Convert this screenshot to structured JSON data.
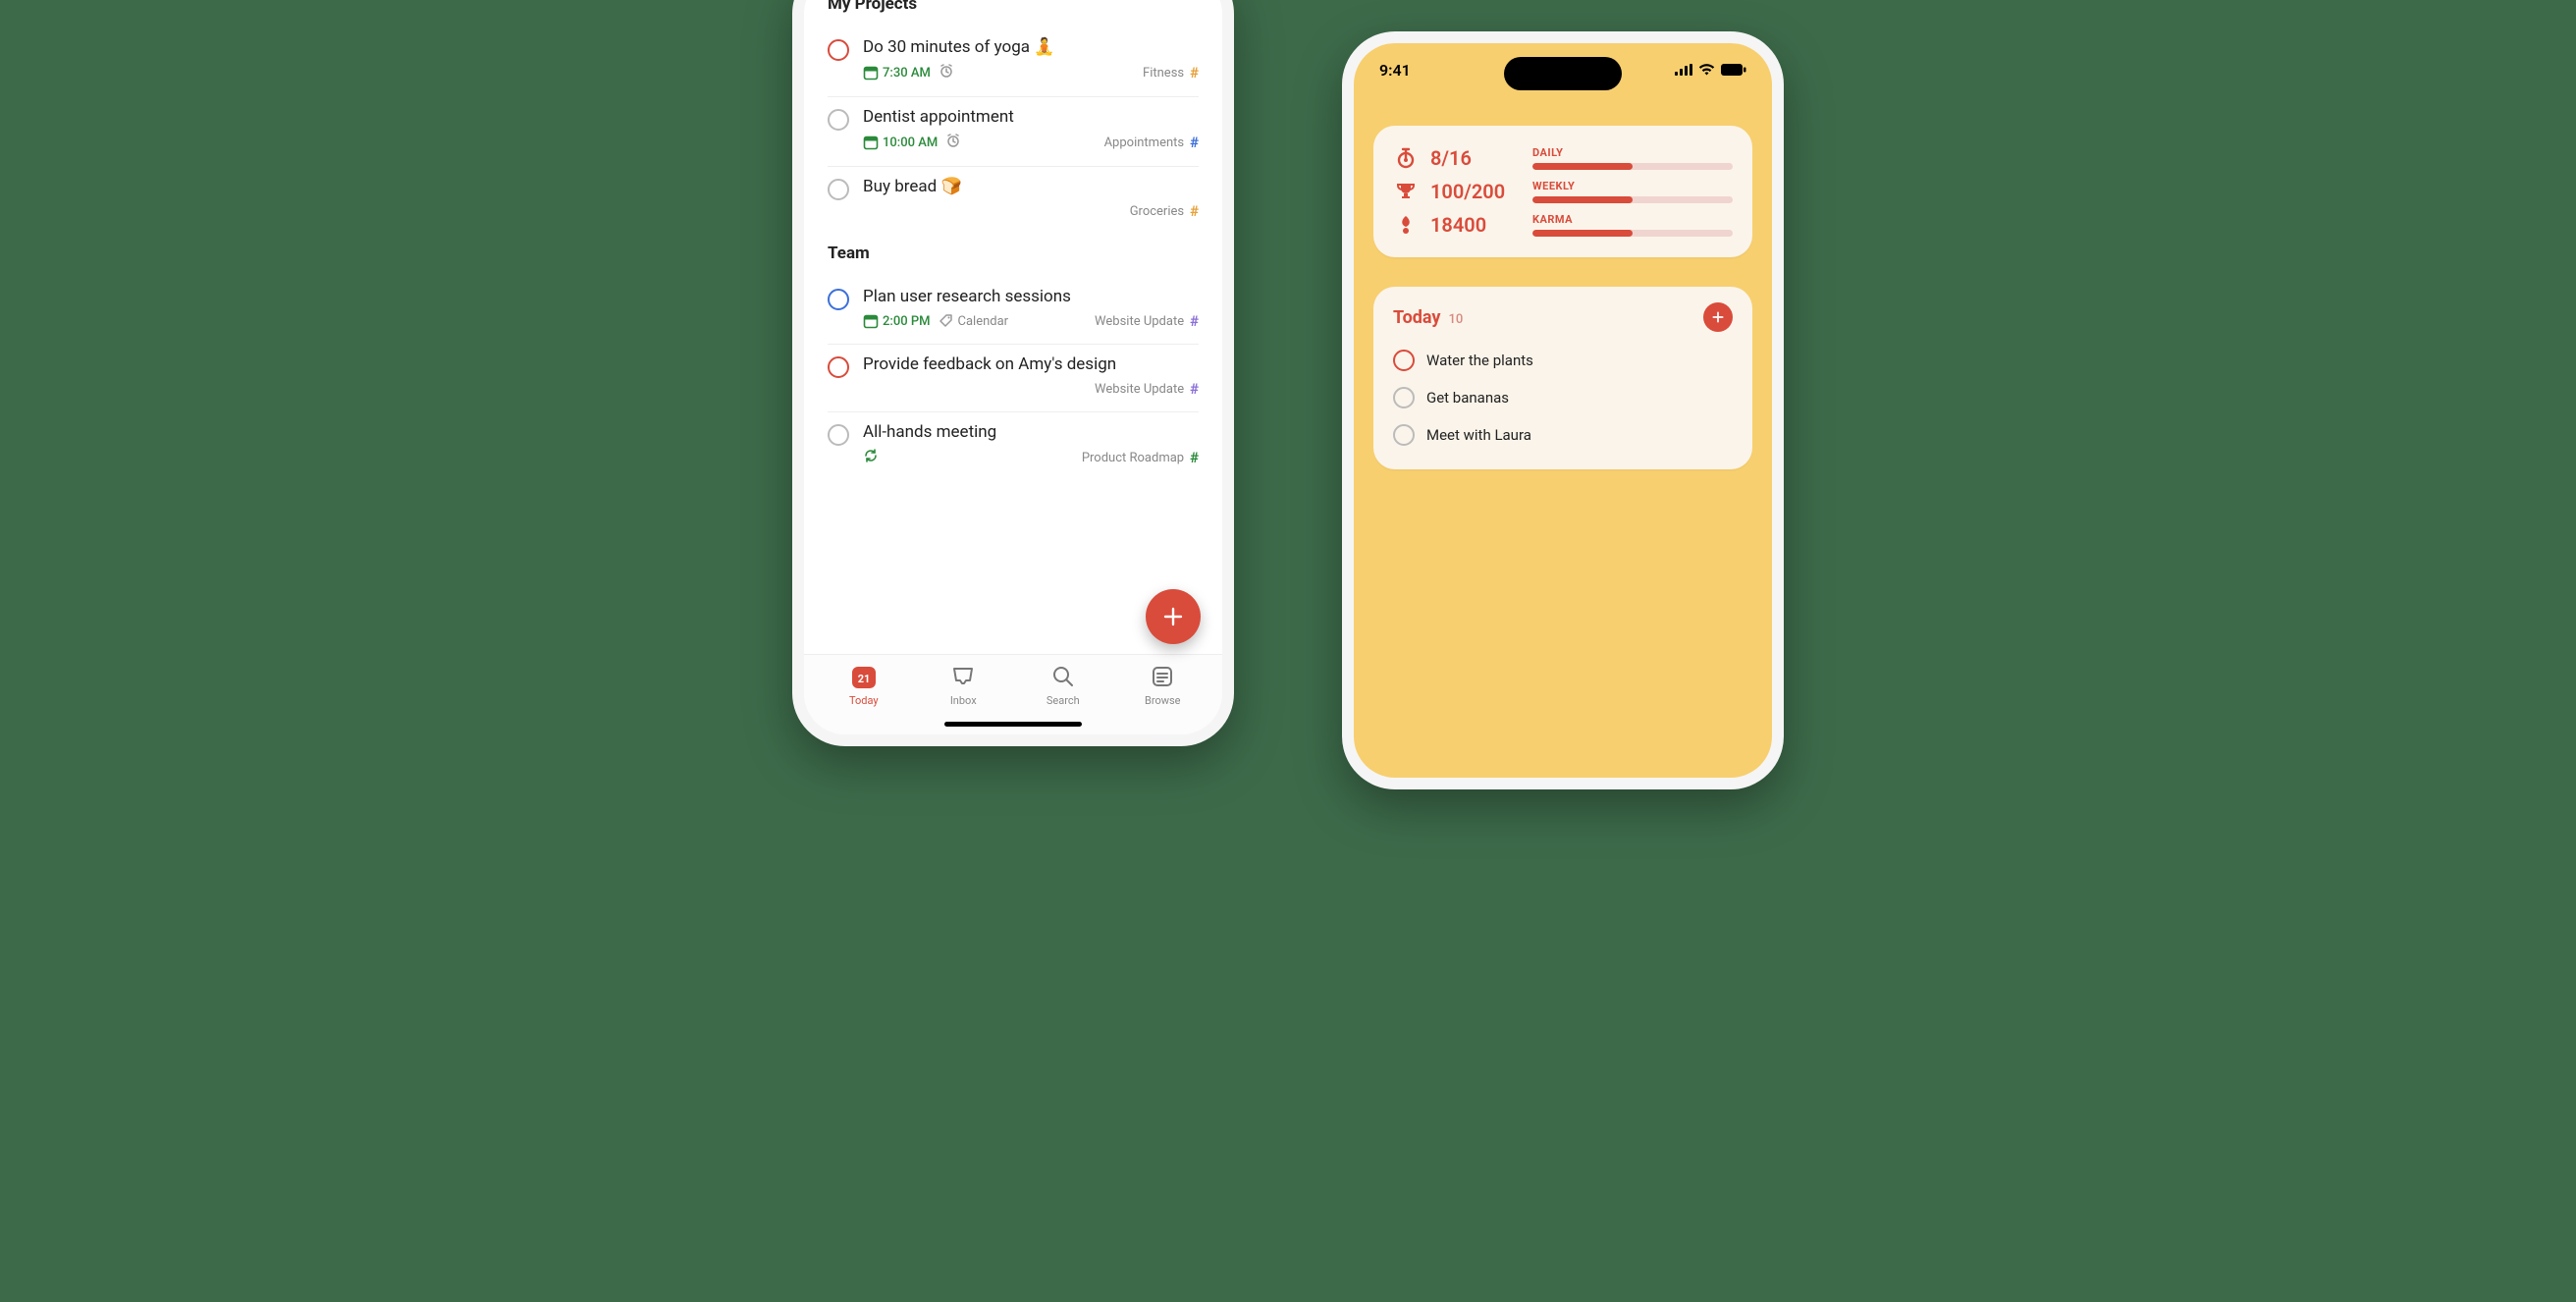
{
  "phone1": {
    "sections": [
      {
        "title": "My Projects",
        "tasks": [
          {
            "title": "Do 30 minutes of yoga 🧘",
            "check_color": "red",
            "time": "7:30 AM",
            "has_alarm": true,
            "extra_label": "",
            "repeat": false,
            "project": "Fitness",
            "hash_color": "orange"
          },
          {
            "title": "Dentist appointment",
            "check_color": "grey",
            "time": "10:00 AM",
            "has_alarm": true,
            "extra_label": "",
            "repeat": false,
            "project": "Appointments",
            "hash_color": "blue"
          },
          {
            "title": "Buy bread 🍞",
            "check_color": "grey",
            "time": "",
            "has_alarm": false,
            "extra_label": "",
            "repeat": false,
            "project": "Groceries",
            "hash_color": "orange"
          }
        ]
      },
      {
        "title": "Team",
        "tasks": [
          {
            "title": "Plan user research sessions",
            "check_color": "blue",
            "time": "2:00 PM",
            "has_alarm": false,
            "extra_label": "Calendar",
            "repeat": false,
            "project": "Website Update",
            "hash_color": "purple"
          },
          {
            "title": "Provide feedback on Amy's design",
            "check_color": "red",
            "time": "",
            "has_alarm": false,
            "extra_label": "",
            "repeat": false,
            "project": "Website Update",
            "hash_color": "purple"
          },
          {
            "title": "All-hands meeting",
            "check_color": "grey",
            "time": "",
            "has_alarm": false,
            "extra_label": "",
            "repeat": true,
            "project": "Product Roadmap",
            "hash_color": "green"
          }
        ]
      }
    ],
    "tabs": [
      {
        "label": "Today",
        "icon": "calendar",
        "date": "21",
        "active": true
      },
      {
        "label": "Inbox",
        "icon": "inbox",
        "active": false
      },
      {
        "label": "Search",
        "icon": "search",
        "active": false
      },
      {
        "label": "Browse",
        "icon": "browse",
        "active": false
      }
    ]
  },
  "phone2": {
    "status_time": "9:41",
    "goals": [
      {
        "icon": "stopwatch",
        "value": "8/16",
        "label": "DAILY",
        "progress": 0.5
      },
      {
        "icon": "trophy",
        "value": "100/200",
        "label": "WEEKLY",
        "progress": 0.5
      },
      {
        "icon": "karma",
        "value": "18400",
        "label": "KARMA",
        "progress": 0.5
      }
    ],
    "today": {
      "title": "Today",
      "count": "10",
      "tasks": [
        {
          "title": "Water the plants",
          "check_color": "red"
        },
        {
          "title": "Get bananas",
          "check_color": "grey"
        },
        {
          "title": "Meet with Laura",
          "check_color": "grey"
        }
      ]
    }
  }
}
